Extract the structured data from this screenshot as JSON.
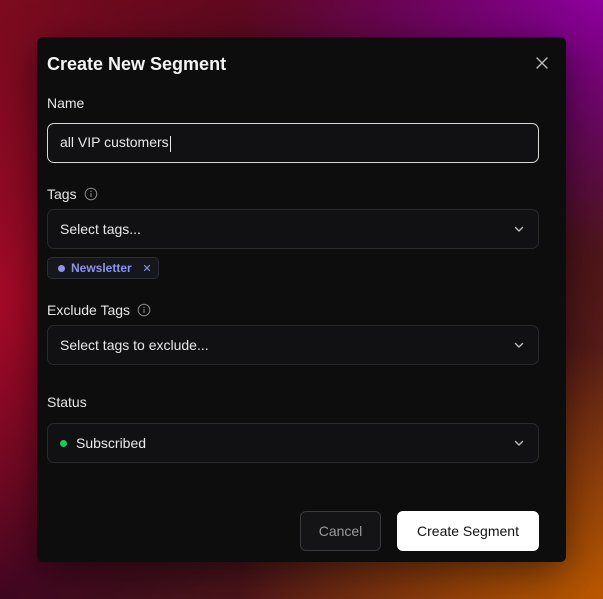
{
  "modal": {
    "title": "Create New Segment",
    "close_icon": "close-icon"
  },
  "name_field": {
    "label": "Name",
    "value": "all VIP customers"
  },
  "tags": {
    "label": "Tags",
    "info_icon": "info-icon",
    "placeholder": "Select tags...",
    "selected": [
      {
        "label": "Newsletter",
        "color": "#8e92f0"
      }
    ]
  },
  "exclude_tags": {
    "label": "Exclude Tags",
    "info_icon": "info-icon",
    "placeholder": "Select tags to exclude..."
  },
  "status": {
    "label": "Status",
    "value": "Subscribed",
    "dot_color": "#22c55e"
  },
  "footer": {
    "cancel_label": "Cancel",
    "create_label": "Create Segment"
  }
}
